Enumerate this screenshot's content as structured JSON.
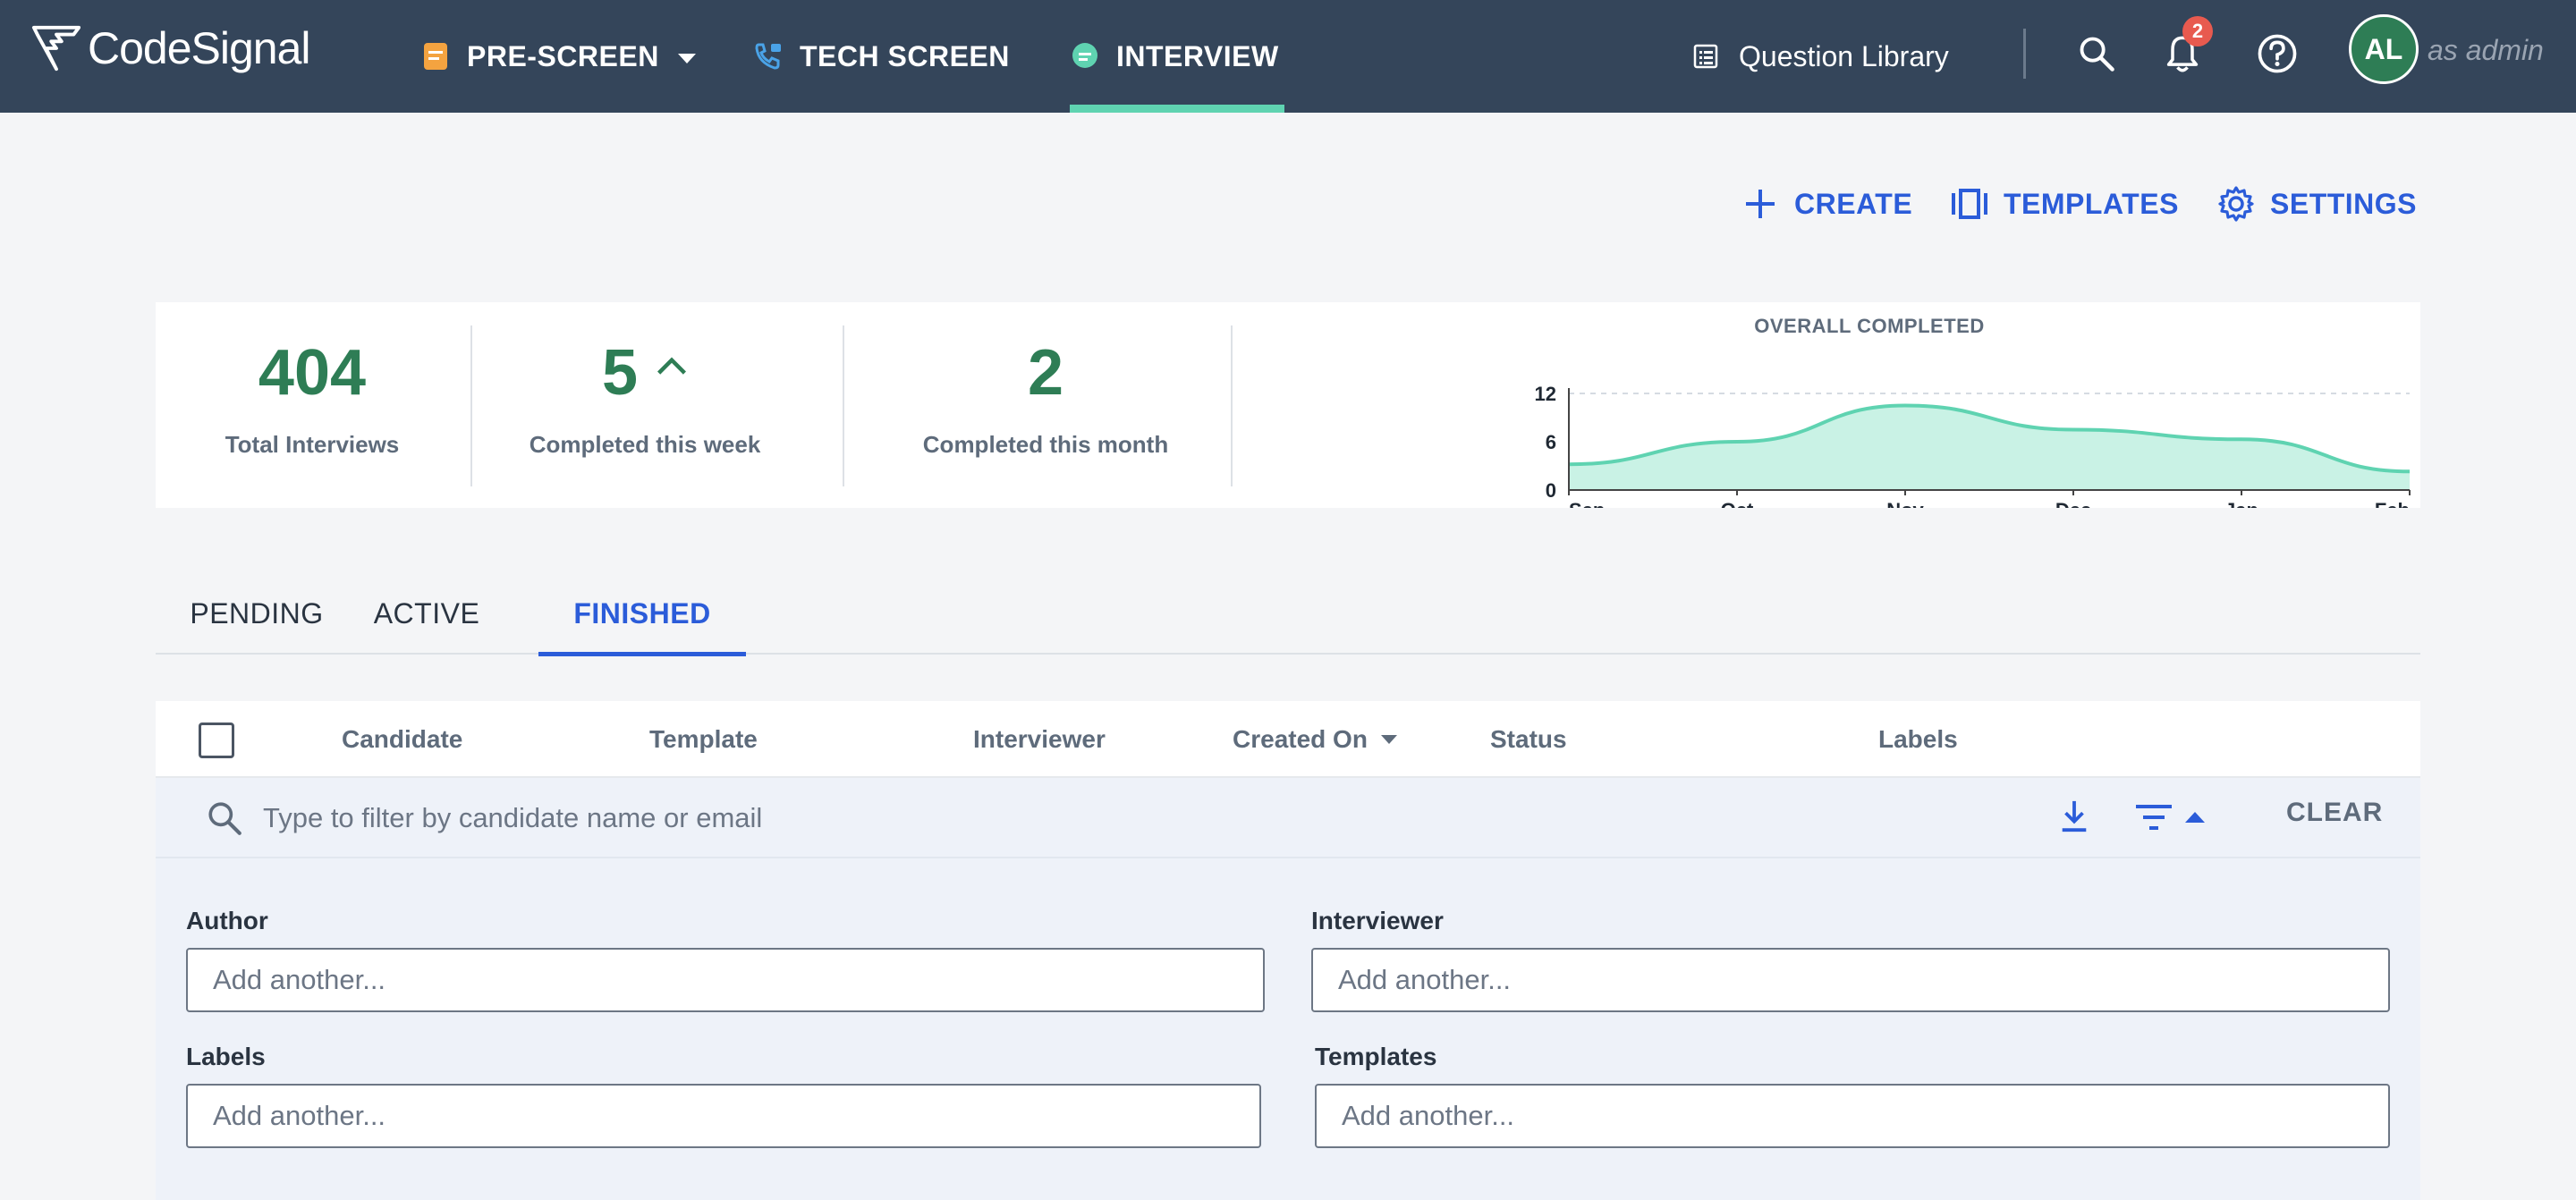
{
  "topnav": {
    "logo_text": "CodeSignal",
    "tabs": [
      {
        "label": "PRE-SCREEN",
        "icon": "document-icon",
        "has_dropdown": true
      },
      {
        "label": "TECH SCREEN",
        "icon": "phone-icon"
      },
      {
        "label": "INTERVIEW",
        "icon": "chat-icon",
        "active": true
      }
    ],
    "question_library": "Question Library",
    "notification_count": "2",
    "avatar_initials": "AL",
    "as_role": "as admin",
    "colors": {
      "bg": "#34455a",
      "active_tab": "#5fd3b1"
    }
  },
  "actions": {
    "create": "CREATE",
    "templates": "TEMPLATES",
    "settings": "SETTINGS"
  },
  "stats": {
    "total_interviews": {
      "value": "404",
      "label": "Total Interviews"
    },
    "completed_week": {
      "value": "5",
      "label": "Completed this week"
    },
    "completed_month": {
      "value": "2",
      "label": "Completed this month"
    }
  },
  "chart_data": {
    "type": "area",
    "title": "OVERALL COMPLETED",
    "categories": [
      "Sep",
      "Oct",
      "Nov",
      "Dec",
      "Jan",
      "Feb"
    ],
    "values": [
      3.2,
      6.0,
      10.5,
      7.5,
      6.3,
      2.3
    ],
    "y_ticks": [
      0,
      6,
      12
    ],
    "ylim": [
      0,
      12
    ],
    "color": "#5fd3b1",
    "fill": "#c9f2e5"
  },
  "tabs": {
    "pending": "PENDING",
    "active": "ACTIVE",
    "finished": "FINISHED"
  },
  "table": {
    "columns": {
      "candidate": "Candidate",
      "template": "Template",
      "interviewer": "Interviewer",
      "created_on": "Created On",
      "status": "Status",
      "labels": "Labels"
    }
  },
  "filter": {
    "search_placeholder": "Type to filter by candidate name or email",
    "clear": "CLEAR"
  },
  "advanced": {
    "author_label": "Author",
    "interviewer_label": "Interviewer",
    "labels_label": "Labels",
    "templates_label": "Templates",
    "placeholder": "Add another..."
  }
}
